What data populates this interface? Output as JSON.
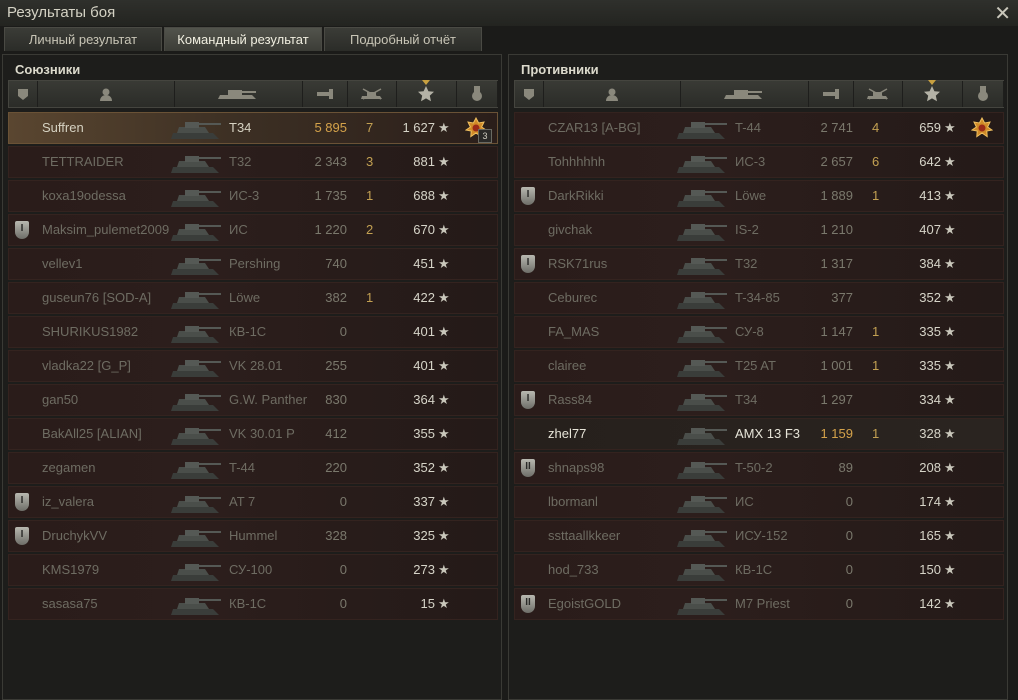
{
  "window": {
    "title": "Результаты боя",
    "close_glyph": "✕"
  },
  "tabs": [
    {
      "label": "Личный результат",
      "active": false
    },
    {
      "label": "Командный результат",
      "active": true
    },
    {
      "label": "Подробный отчёт",
      "active": false
    }
  ],
  "allies": {
    "title": "Союзники",
    "rows": [
      {
        "name": "Suffren",
        "tank": "T34",
        "damage": "5 895",
        "frags": "7",
        "xp": "1 627",
        "rank": "",
        "self": true,
        "medal": "3"
      },
      {
        "name": "TETTRAIDER",
        "tank": "T32",
        "damage": "2 343",
        "frags": "3",
        "xp": "881",
        "rank": ""
      },
      {
        "name": "koxa19odessa",
        "tank": "ИС-3",
        "damage": "1 735",
        "frags": "1",
        "xp": "688",
        "rank": ""
      },
      {
        "name": "Maksim_pulemet2009",
        "tank": "ИС",
        "damage": "1 220",
        "frags": "2",
        "xp": "670",
        "rank": "I"
      },
      {
        "name": "vellev1",
        "tank": "Pershing",
        "damage": "740",
        "frags": "",
        "xp": "451",
        "rank": ""
      },
      {
        "name": "guseun76 [SOD-A]",
        "tank": "Löwe",
        "damage": "382",
        "frags": "1",
        "xp": "422",
        "rank": ""
      },
      {
        "name": "SHURIKUS1982",
        "tank": "КВ-1С",
        "damage": "0",
        "frags": "",
        "xp": "401",
        "rank": ""
      },
      {
        "name": "vladka22 [G_P]",
        "tank": "VK 28.01",
        "damage": "255",
        "frags": "",
        "xp": "401",
        "rank": ""
      },
      {
        "name": "gan50",
        "tank": "G.W. Panther",
        "damage": "830",
        "frags": "",
        "xp": "364",
        "rank": ""
      },
      {
        "name": "BakAll25 [ALIAN]",
        "tank": "VK 30.01 P",
        "damage": "412",
        "frags": "",
        "xp": "355",
        "rank": ""
      },
      {
        "name": "zegamen",
        "tank": "T-44",
        "damage": "220",
        "frags": "",
        "xp": "352",
        "rank": ""
      },
      {
        "name": "iz_valera",
        "tank": "AT 7",
        "damage": "0",
        "frags": "",
        "xp": "337",
        "rank": "I"
      },
      {
        "name": "DruchykVV",
        "tank": "Hummel",
        "damage": "328",
        "frags": "",
        "xp": "325",
        "rank": "I"
      },
      {
        "name": "KMS1979",
        "tank": "СУ-100",
        "damage": "0",
        "frags": "",
        "xp": "273",
        "rank": ""
      },
      {
        "name": "sasasa75",
        "tank": "КВ-1С",
        "damage": "0",
        "frags": "",
        "xp": "15",
        "rank": ""
      }
    ]
  },
  "enemies": {
    "title": "Противники",
    "rows": [
      {
        "name": "CZAR13 [A-BG]",
        "tank": "T-44",
        "damage": "2 741",
        "frags": "4",
        "xp": "659",
        "rank": "",
        "medal": ""
      },
      {
        "name": "Tohhhhhh",
        "tank": "ИС-3",
        "damage": "2 657",
        "frags": "6",
        "xp": "642",
        "rank": ""
      },
      {
        "name": "DarkRikki",
        "tank": "Löwe",
        "damage": "1 889",
        "frags": "1",
        "xp": "413",
        "rank": "I"
      },
      {
        "name": "givchak",
        "tank": "IS-2",
        "damage": "1 210",
        "frags": "",
        "xp": "407",
        "rank": ""
      },
      {
        "name": "RSK71rus",
        "tank": "T32",
        "damage": "1 317",
        "frags": "",
        "xp": "384",
        "rank": "I"
      },
      {
        "name": "Ceburec",
        "tank": "T-34-85",
        "damage": "377",
        "frags": "",
        "xp": "352",
        "rank": ""
      },
      {
        "name": "FA_MAS",
        "tank": "СУ-8",
        "damage": "1 147",
        "frags": "1",
        "xp": "335",
        "rank": ""
      },
      {
        "name": "clairee",
        "tank": "T25 AT",
        "damage": "1 001",
        "frags": "1",
        "xp": "335",
        "rank": ""
      },
      {
        "name": "Rass84",
        "tank": "T34",
        "damage": "1 297",
        "frags": "",
        "xp": "334",
        "rank": "I"
      },
      {
        "name": "zhel77",
        "tank": "AMX 13 F3",
        "damage": "1 159",
        "frags": "1",
        "xp": "328",
        "rank": "",
        "hl": true
      },
      {
        "name": "shnaps98",
        "tank": "T-50-2",
        "damage": "89",
        "frags": "",
        "xp": "208",
        "rank": "II"
      },
      {
        "name": "lbormanl",
        "tank": "ИС",
        "damage": "0",
        "frags": "",
        "xp": "174",
        "rank": ""
      },
      {
        "name": "ssttaallkkeer",
        "tank": "ИСУ-152",
        "damage": "0",
        "frags": "",
        "xp": "165",
        "rank": ""
      },
      {
        "name": "hod_733",
        "tank": "КВ-1С",
        "damage": "0",
        "frags": "",
        "xp": "150",
        "rank": ""
      },
      {
        "name": "EgoistGOLD",
        "tank": "M7 Priest",
        "damage": "0",
        "frags": "",
        "xp": "142",
        "rank": "II"
      }
    ]
  },
  "columns": [
    "squad-icon",
    "player-icon",
    "tank-icon",
    "damage-icon",
    "frags-icon",
    "xp-star-icon",
    "medal-icon"
  ],
  "colors": {
    "accent": "#c8a040",
    "self_row": "#5a4630",
    "row_bg": "#2a1c1a"
  },
  "star_glyph": "★"
}
